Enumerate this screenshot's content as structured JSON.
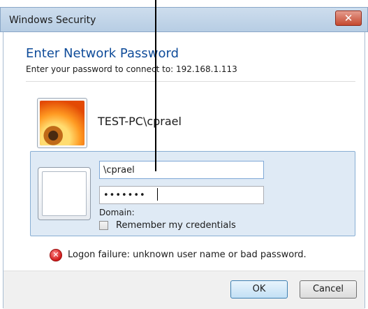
{
  "window": {
    "title": "Windows Security",
    "close_glyph": "✕"
  },
  "dialog": {
    "heading": "Enter Network Password",
    "subheading": "Enter your password to connect to: 192.168.1.113",
    "current_user": "TEST-PC\\cprael"
  },
  "credentials": {
    "username_value": "\\cprael",
    "password_mask": "•••••••",
    "domain_label": "Domain:",
    "remember_label": "Remember my credentials",
    "remember_checked": false
  },
  "error": {
    "icon": "error-x-icon",
    "message": "Logon failure: unknown user name or bad password."
  },
  "buttons": {
    "ok": "OK",
    "cancel": "Cancel"
  }
}
